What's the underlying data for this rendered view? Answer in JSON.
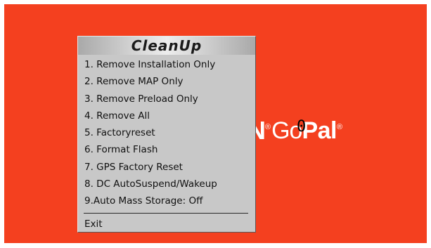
{
  "background": {
    "color": "#f4401f"
  },
  "brand": {
    "mark": "N",
    "registered": "®",
    "go": "Go",
    "pal": "Pal",
    "registered_after": "®",
    "text_color": "#ffffff"
  },
  "overlay_char": "0",
  "menu": {
    "title": "CleanUp",
    "items": [
      "1. Remove Installation Only",
      "2. Remove MAP Only",
      "3. Remove Preload Only",
      "4. Remove All",
      "5. Factoryreset",
      "6. Format Flash",
      "7. GPS Factory Reset",
      "8. DC AutoSuspend/Wakeup",
      "9.Auto Mass Storage: Off"
    ],
    "exit": "Exit"
  }
}
